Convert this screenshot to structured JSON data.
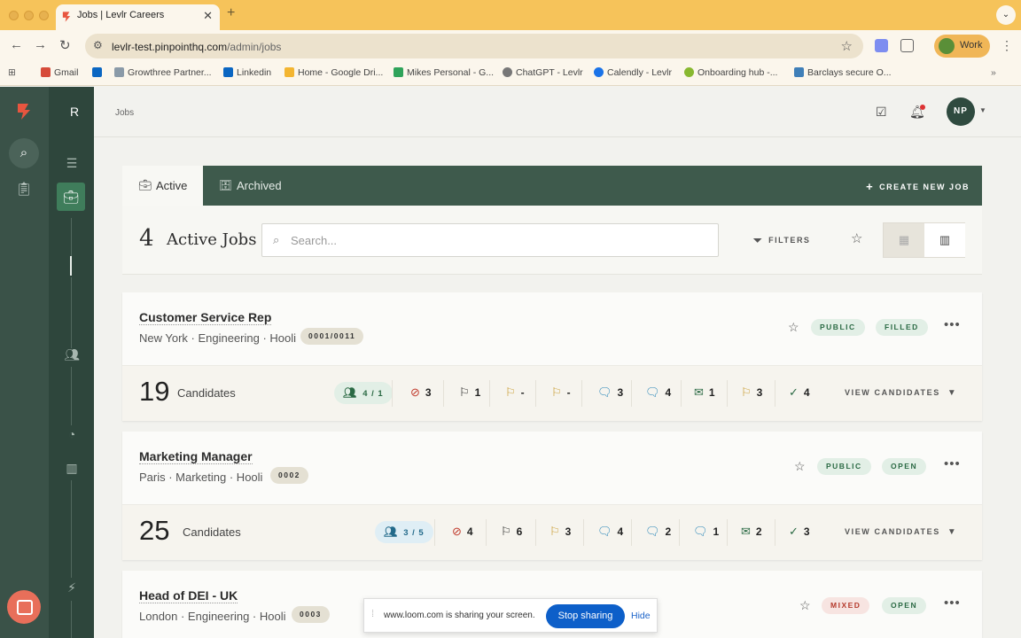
{
  "browser": {
    "tab_title": "Jobs | Levlr Careers",
    "url_host": "levlr-test.pinpointhq.com",
    "url_path": "/admin/jobs",
    "profile_label": "Work",
    "bookmarks": [
      {
        "label": "Gmail",
        "color": "#d64b3a"
      },
      {
        "label": "",
        "color": "#0a66c2"
      },
      {
        "label": "Growthree Partner...",
        "color": "#8a9aa8"
      },
      {
        "label": "Linkedin",
        "color": "#0a66c2"
      },
      {
        "label": "Home - Google Dri...",
        "color": "#f3b531"
      },
      {
        "label": "Mikes Personal - G...",
        "color": "#2fa35a"
      },
      {
        "label": "ChatGPT - Levlr",
        "color": "#777777"
      },
      {
        "label": "Calendly - Levlr",
        "color": "#1a73e8"
      },
      {
        "label": "Onboarding hub -...",
        "color": "#88b830"
      },
      {
        "label": "Barclays secure O...",
        "color": "#3f7fb8"
      }
    ]
  },
  "sidebar": {
    "workspace_letter": "R"
  },
  "header": {
    "breadcrumb": "Jobs",
    "avatar_initials": "NP"
  },
  "tabs": {
    "active": "Active",
    "archived": "Archived",
    "create": "CREATE NEW JOB"
  },
  "toolbar": {
    "count": "4",
    "label": "Active Jobs",
    "search_placeholder": "Search...",
    "filters": "FILTERS"
  },
  "jobs": [
    {
      "title": "Customer Service Rep",
      "meta": "New York · Engineering · Hooli",
      "id": "0001/0011",
      "visibility": "PUBLIC",
      "status": "FILLED",
      "candidates": "19",
      "candidates_label": "Candidates",
      "stage": "4 / 1",
      "stats": [
        "3",
        "1",
        "-",
        "-",
        "3",
        "4",
        "1",
        "3",
        "4"
      ],
      "view": "VIEW CANDIDATES"
    },
    {
      "title": "Marketing Manager",
      "meta": "Paris · Marketing · Hooli",
      "id": "0002",
      "visibility": "PUBLIC",
      "status": "OPEN",
      "candidates": "25",
      "candidates_label": "Candidates",
      "stage": "3 / 5",
      "stats": [
        "4",
        "6",
        "3",
        "4",
        "2",
        "1",
        "2",
        "3"
      ],
      "view": "VIEW CANDIDATES"
    },
    {
      "title": "Head of DEI - UK",
      "meta": "London · Engineering · Hooli",
      "id": "0003",
      "visibility": "MIXED",
      "status": "OPEN"
    }
  ],
  "loom": {
    "message": "www.loom.com is sharing your screen.",
    "stop": "Stop sharing",
    "hide": "Hide"
  }
}
